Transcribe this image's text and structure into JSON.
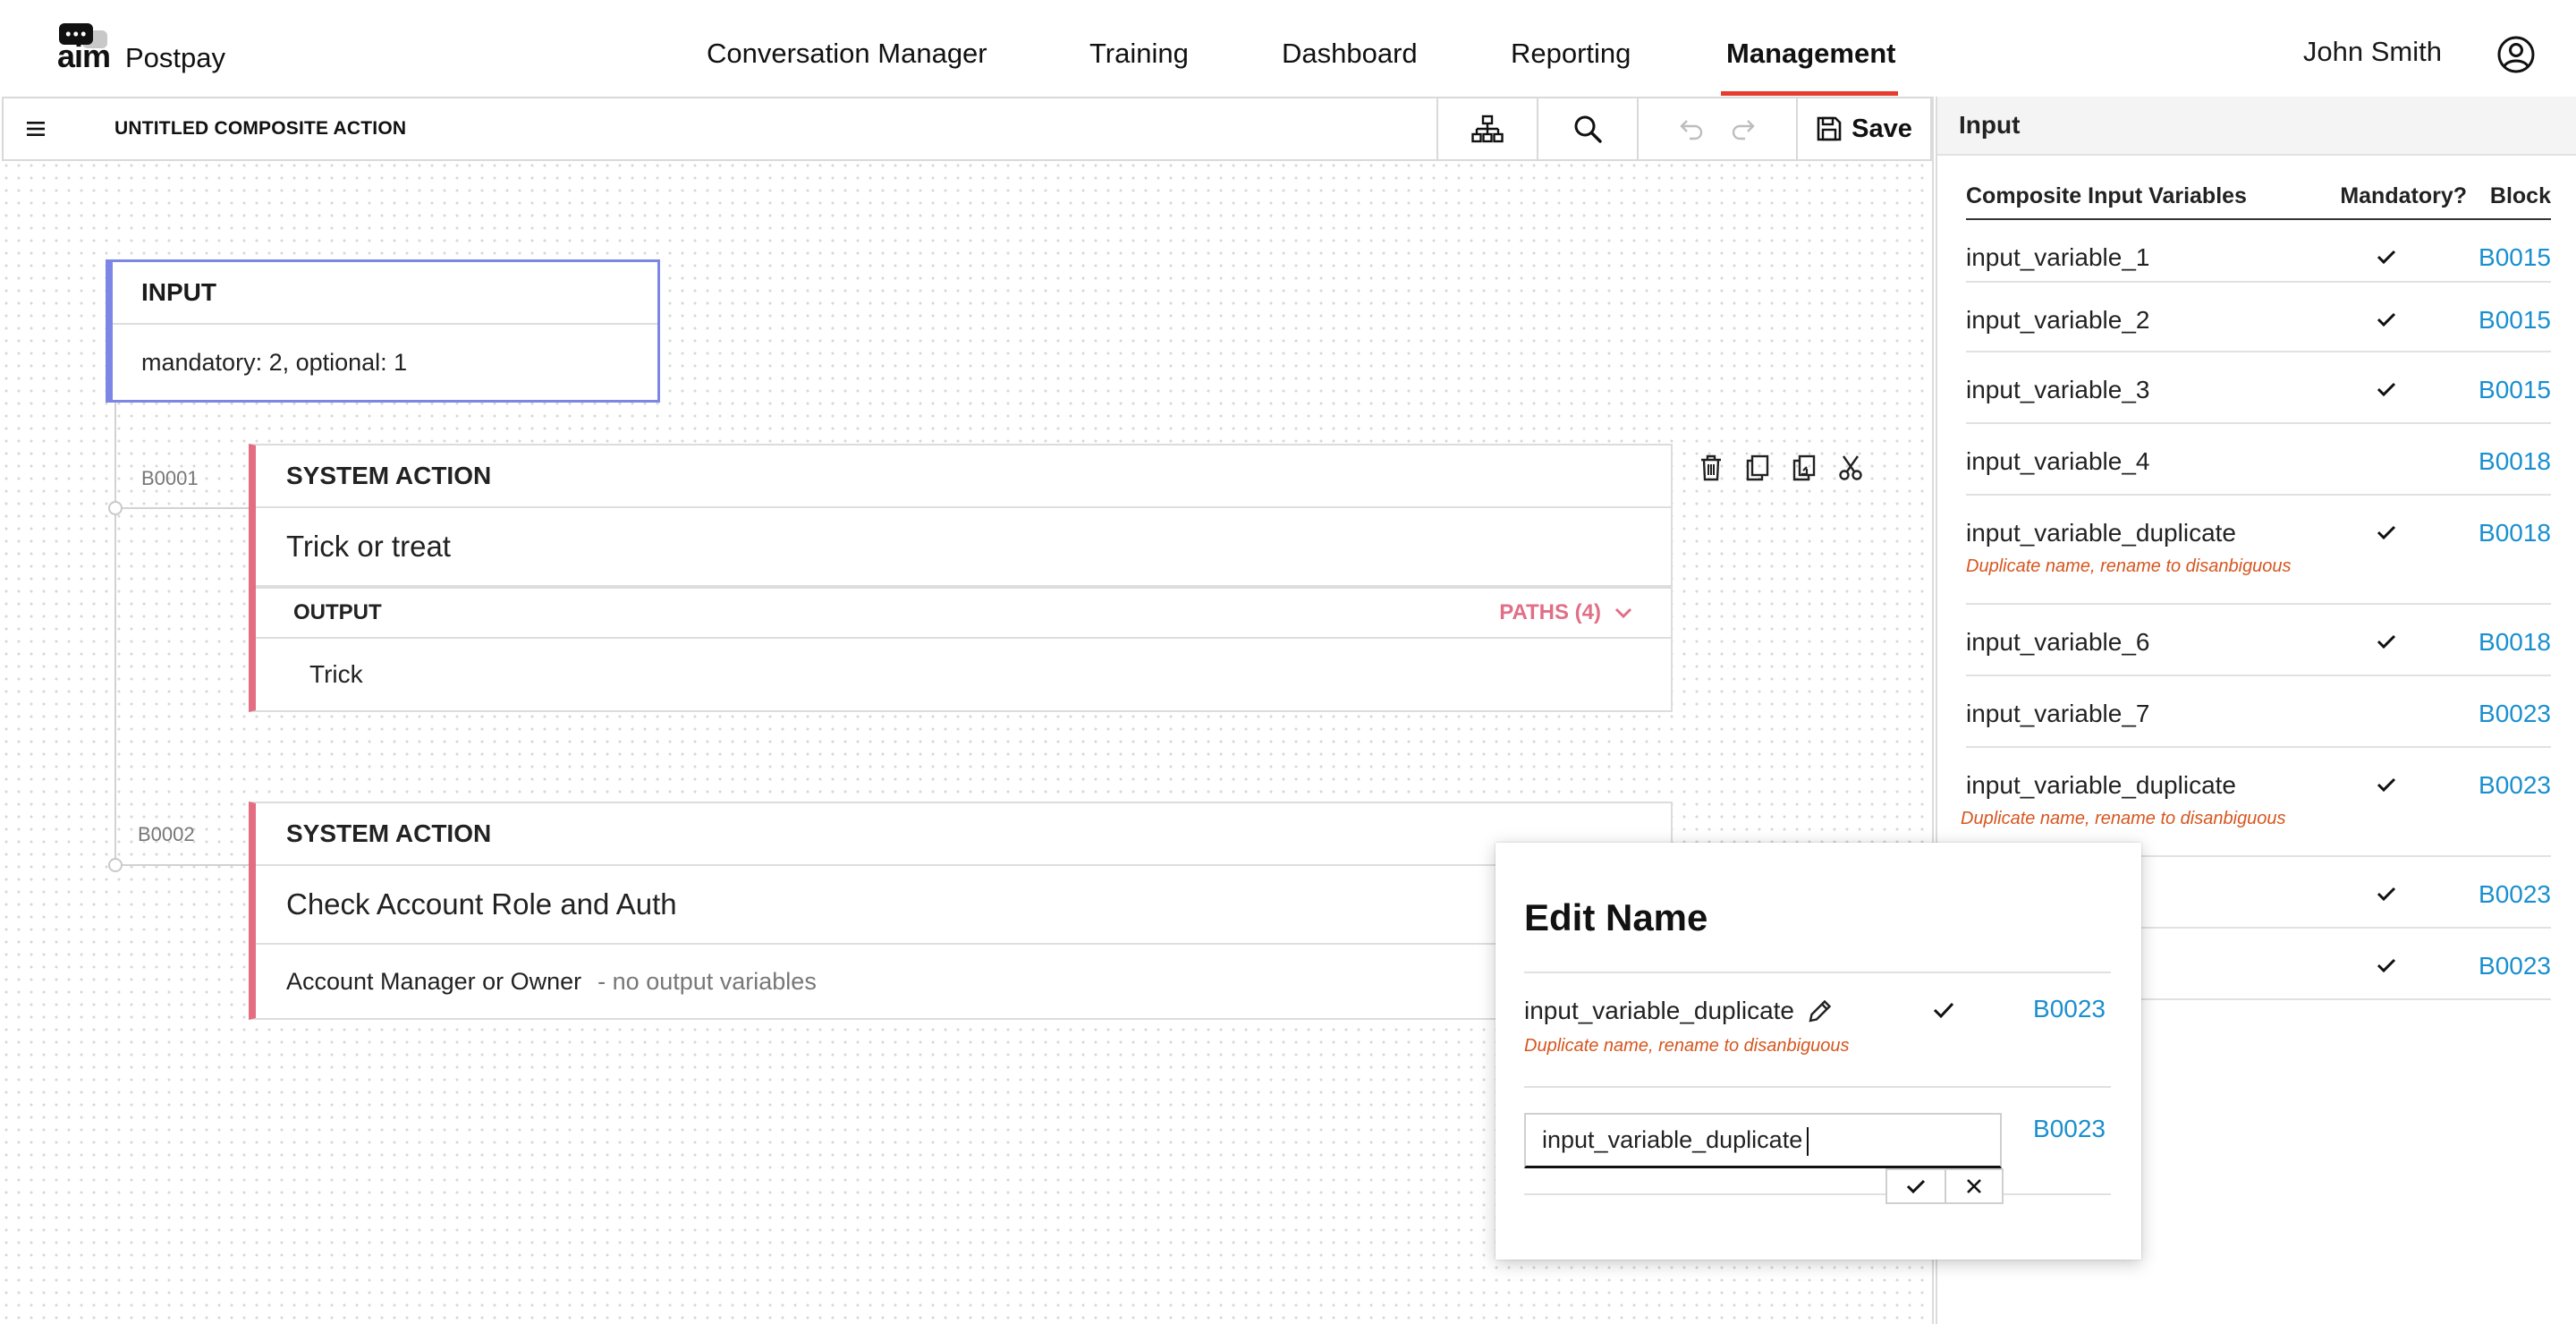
{
  "brand": {
    "logo_mark": "aim",
    "name": "Postpay"
  },
  "nav": {
    "items": [
      {
        "label": "Conversation Manager"
      },
      {
        "label": "Training"
      },
      {
        "label": "Dashboard"
      },
      {
        "label": "Reporting"
      },
      {
        "label": "Management",
        "active": true
      }
    ]
  },
  "user": {
    "name": "John Smith",
    "icon": "user-circle-icon"
  },
  "toolbar": {
    "title": "UNTITLED COMPOSITE ACTION",
    "icons": [
      "menu-icon",
      "hierarchy-icon",
      "search-icon",
      "undo-icon",
      "redo-icon",
      "save-icon"
    ],
    "save_label": "Save"
  },
  "canvas": {
    "input_block": {
      "header": "INPUT",
      "summary": "mandatory: 2,  optional: 1"
    },
    "blocks": [
      {
        "id": "B0001",
        "type": "SYSTEM ACTION",
        "title": "Trick or treat",
        "output_label": "OUTPUT",
        "paths_label": "PATHS (4)",
        "output_value": "Trick"
      },
      {
        "id": "B0002",
        "type": "SYSTEM ACTION",
        "title": "Check Account Role and Auth",
        "output_value": "Account Manager or Owner",
        "output_note": "- no output variables"
      }
    ],
    "block_action_icons": [
      "trash-icon",
      "copy-icon",
      "paste-icon",
      "cut-icon"
    ]
  },
  "panel": {
    "title": "Input",
    "columns": {
      "name": "Composite Input Variables",
      "mandatory": "Mandatory?",
      "block": "Block"
    },
    "rows": [
      {
        "name": "input_variable_1",
        "mandatory": true,
        "block": "B0015",
        "error": ""
      },
      {
        "name": "input_variable_2",
        "mandatory": true,
        "block": "B0015",
        "error": ""
      },
      {
        "name": "input_variable_3",
        "mandatory": true,
        "block": "B0015",
        "error": ""
      },
      {
        "name": "input_variable_4",
        "mandatory": false,
        "block": "B0018",
        "error": ""
      },
      {
        "name": "input_variable_duplicate",
        "mandatory": true,
        "block": "B0018",
        "error": "Duplicate name, rename to disanbiguous"
      },
      {
        "name": "input_variable_6",
        "mandatory": true,
        "block": "B0018",
        "error": ""
      },
      {
        "name": "input_variable_7",
        "mandatory": false,
        "block": "B0023",
        "error": ""
      },
      {
        "name": "input_variable_duplicate",
        "mandatory": true,
        "block": "B0023",
        "error": "Duplicate name, rename to disanbiguous"
      },
      {
        "name": "",
        "mandatory": true,
        "block": "B0023",
        "error": ""
      },
      {
        "name": "",
        "mandatory": true,
        "block": "B0023",
        "error": ""
      }
    ]
  },
  "dialog": {
    "title": "Edit Name",
    "current": {
      "name": "input_variable_duplicate",
      "mandatory": true,
      "block": "B0023",
      "error": "Duplicate name, rename to disanbiguous"
    },
    "edit": {
      "value": "input_variable_duplicate",
      "block": "B0023"
    },
    "colors": {
      "error": "#d6561f",
      "link": "#1a8fcf"
    }
  },
  "colors": {
    "nav_active_underline": "#e63b2e",
    "input_block": "#7b86e6",
    "system_block": "#e46d82",
    "paths": "#e06f87"
  }
}
